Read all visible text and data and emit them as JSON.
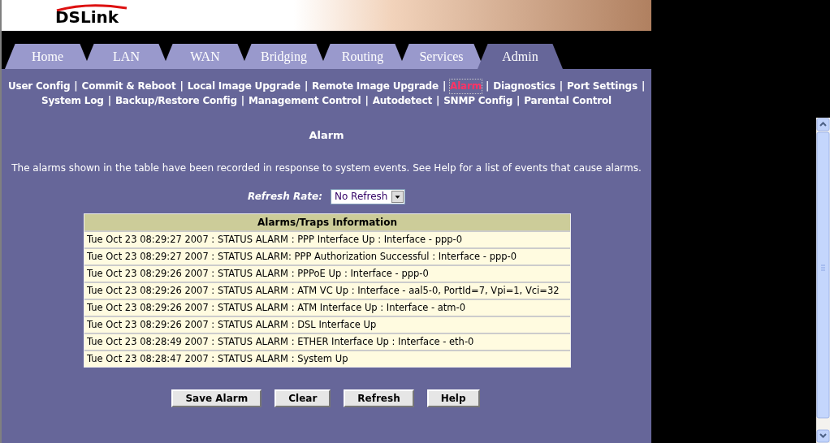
{
  "logo": {
    "text": "DSLink"
  },
  "tabs": [
    {
      "label": "Home",
      "selected": false
    },
    {
      "label": "LAN",
      "selected": false
    },
    {
      "label": "WAN",
      "selected": false
    },
    {
      "label": "Bridging",
      "selected": false
    },
    {
      "label": "Routing",
      "selected": false
    },
    {
      "label": "Services",
      "selected": false
    },
    {
      "label": "Admin",
      "selected": true
    }
  ],
  "submenu": [
    [
      {
        "label": "User Config",
        "selected": false
      },
      {
        "label": "Commit & Reboot",
        "selected": false
      },
      {
        "label": "Local Image Upgrade",
        "selected": false
      },
      {
        "label": "Remote Image Upgrade",
        "selected": false
      },
      {
        "label": "Alarm",
        "selected": true
      },
      {
        "label": "Diagnostics",
        "selected": false
      },
      {
        "label": "Port Settings",
        "selected": false
      }
    ],
    [
      {
        "label": "System Log",
        "selected": false
      },
      {
        "label": "Backup/Restore Config",
        "selected": false
      },
      {
        "label": "Management Control",
        "selected": false
      },
      {
        "label": "Autodetect",
        "selected": false
      },
      {
        "label": "SNMP Config",
        "selected": false
      },
      {
        "label": "Parental Control",
        "selected": false
      }
    ]
  ],
  "separator": "|",
  "page_title": "Alarm",
  "description": "The alarms shown in the table have been recorded in response to system events. See Help for a list of events that cause alarms.",
  "refresh_rate": {
    "label": "Refresh Rate:",
    "value": "No Refresh"
  },
  "table": {
    "title": "Alarms/Traps Information",
    "rows": [
      "Tue Oct 23 08:29:27 2007 : STATUS ALARM : PPP Interface Up : Interface - ppp-0",
      "Tue Oct 23 08:29:27 2007 : STATUS ALARM: PPP Authorization Successful : Interface - ppp-0",
      "Tue Oct 23 08:29:26 2007 : STATUS ALARM : PPPoE Up : Interface - ppp-0",
      "Tue Oct 23 08:29:26 2007 : STATUS ALARM : ATM VC Up : Interface - aal5-0, PortId=7, Vpi=1, Vci=32",
      "Tue Oct 23 08:29:26 2007 : STATUS ALARM : ATM Interface Up : Interface - atm-0",
      "Tue Oct 23 08:29:26 2007 : STATUS ALARM : DSL Interface Up",
      "Tue Oct 23 08:28:49 2007 : STATUS ALARM : ETHER Interface Up : Interface - eth-0",
      "Tue Oct 23 08:28:47 2007 : STATUS ALARM : System Up"
    ]
  },
  "buttons": [
    "Save Alarm",
    "Clear",
    "Refresh",
    "Help"
  ]
}
